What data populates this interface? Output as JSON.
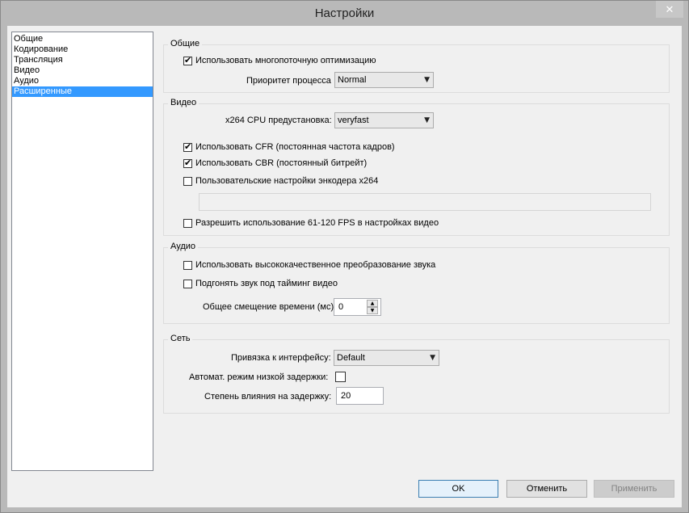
{
  "window": {
    "title": "Настройки",
    "close_glyph": "✕"
  },
  "sidebar": {
    "items": [
      {
        "label": "Общие"
      },
      {
        "label": "Кодирование"
      },
      {
        "label": "Трансляция"
      },
      {
        "label": "Видео"
      },
      {
        "label": "Аудио"
      },
      {
        "label": "Расширенные",
        "selected": true
      }
    ]
  },
  "general": {
    "group_label": "Общие",
    "multithread_label": "Использовать многопоточную оптимизацию",
    "multithread_checked": true,
    "priority_label": "Приоритет процесса",
    "priority_value": "Normal"
  },
  "video": {
    "group_label": "Видео",
    "preset_label": "x264 CPU предустановка:",
    "preset_value": "veryfast",
    "cfr_label": "Использовать CFR (постоянная частота кадров)",
    "cfr_checked": true,
    "cbr_label": "Использовать CBR (постоянный битрейт)",
    "cbr_checked": true,
    "custom_x264_label": "Пользовательские настройки энкодера x264",
    "custom_x264_checked": false,
    "custom_x264_value": "",
    "fps_label": "Разрешить использование 61-120 FPS в настройках видео",
    "fps_checked": false
  },
  "audio": {
    "group_label": "Аудио",
    "hq_resample_label": "Использовать высококачественное преобразование звука",
    "hq_resample_checked": false,
    "sync_label": "Подгонять звук под тайминг видео",
    "sync_checked": false,
    "offset_label": "Общее смещение времени (мс):",
    "offset_value": "0"
  },
  "network": {
    "group_label": "Сеть",
    "bind_label": "Привязка к интерфейсу:",
    "bind_value": "Default",
    "low_latency_label": "Автомат. режим низкой задержки:",
    "low_latency_checked": false,
    "latency_factor_label": "Степень влияния на задержку:",
    "latency_factor_value": "20"
  },
  "buttons": {
    "ok": "OK",
    "cancel": "Отменить",
    "apply": "Применить"
  },
  "icons": {
    "dropdown_arrow": "▼",
    "spin_up": "▲",
    "spin_down": "▼"
  }
}
